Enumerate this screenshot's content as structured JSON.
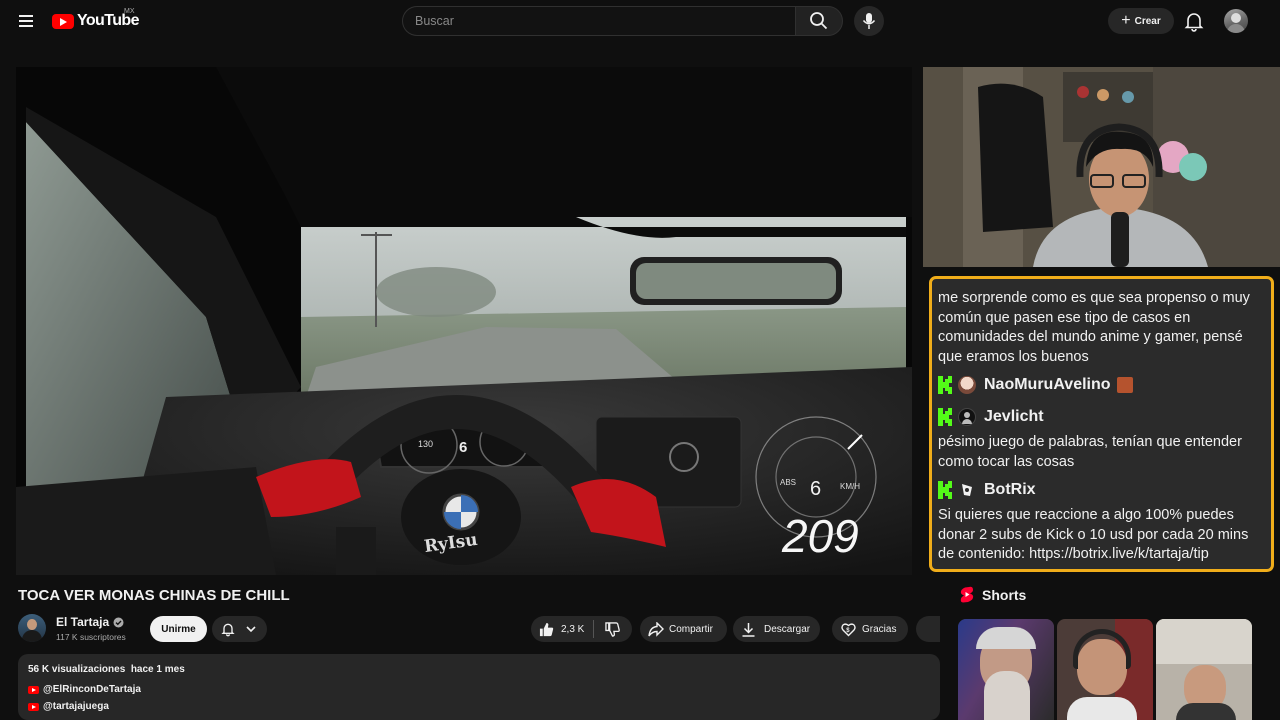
{
  "header": {
    "logo_text": "YouTube",
    "country_code": "MX",
    "search_placeholder": "Buscar",
    "create_label": "Crear"
  },
  "player": {
    "speed_readout": "209",
    "gear_readout": "6",
    "cluster_speed": "130",
    "cluster_gear": "6",
    "speed_unit": "KM/H"
  },
  "chat": {
    "messages": [
      {
        "user": "",
        "text": "me sorprende como es que sea propenso o muy común que pasen ese tipo de casos en comunidades del mundo anime y gamer, pensé que eramos los buenos"
      },
      {
        "user": "NaoMuruAvelino",
        "text": ""
      },
      {
        "user": "Jevlicht",
        "text": "pésimo juego de palabras, tenían que entender como tocar las cosas"
      },
      {
        "user": "BotRix",
        "text": "Si quieres que reaccione a algo 100% puedes donar 2 subs de Kick o 10 usd por cada 20 mins de contenido: https://botrix.live/k/tartaja/tip"
      }
    ]
  },
  "video": {
    "title": "TOCA VER MONAS CHINAS DE CHILL",
    "channel_name": "El Tartaja",
    "subscribers": "117 K suscriptores",
    "join_label": "Unirme",
    "likes": "2,3 K",
    "share_label": "Compartir",
    "download_label": "Descargar",
    "thanks_label": "Gracias"
  },
  "description": {
    "stats": "56 K visualizaciones  hace 1 mes",
    "links": [
      "@ElRinconDeTartaja",
      "@tartajajuega"
    ]
  },
  "shorts": {
    "heading": "Shorts"
  },
  "colors": {
    "accent_red": "#ff0000",
    "chat_border": "#f0ad1a",
    "kick_green": "#53fc18",
    "background": "#0f0f0f"
  },
  "icons": [
    "menu-icon",
    "search-icon",
    "mic-icon",
    "plus-icon",
    "bell-icon",
    "like-icon",
    "dislike-icon",
    "share-icon",
    "download-icon",
    "thanks-icon",
    "verified-icon",
    "shorts-icon",
    "kick-icon"
  ]
}
